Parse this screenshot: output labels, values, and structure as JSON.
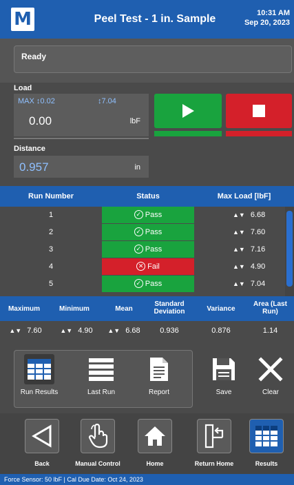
{
  "header": {
    "logo_text": "M",
    "title": "Peel Test - 1 in. Sample",
    "time": "10:31 AM",
    "date": "Sep 20, 2023"
  },
  "status": {
    "text": "Ready"
  },
  "load": {
    "label": "Load",
    "max_label": "MAX",
    "max_value": "0.02",
    "min_value": "7.04",
    "value": "0.00",
    "unit": "lbF"
  },
  "distance": {
    "label": "Distance",
    "value": "0.957",
    "unit": "in"
  },
  "results": {
    "headers": [
      "Run Number",
      "Status",
      "Max Load [lbF]"
    ],
    "rows": [
      {
        "run": "1",
        "status": "Pass",
        "max": "6.68"
      },
      {
        "run": "2",
        "status": "Pass",
        "max": "7.60"
      },
      {
        "run": "3",
        "status": "Pass",
        "max": "7.16"
      },
      {
        "run": "4",
        "status": "Fail",
        "max": "4.90"
      },
      {
        "run": "5",
        "status": "Pass",
        "max": "7.04"
      }
    ]
  },
  "stats": {
    "headers": [
      "Maximum",
      "Minimum",
      "Mean",
      "Standard Deviation",
      "Variance",
      "Area (Last Run)"
    ],
    "values": [
      "7.60",
      "4.90",
      "6.68",
      "0.936",
      "0.876",
      "1.14"
    ]
  },
  "actions": {
    "run_results": "Run Results",
    "last_run": "Last Run",
    "report": "Report",
    "save": "Save",
    "clear": "Clear"
  },
  "nav": {
    "back": "Back",
    "manual_control": "Manual Control",
    "home": "Home",
    "return_home": "Return Home",
    "results": "Results"
  },
  "footer": {
    "text": "Force Sensor: 50 lbF  |  Cal Due Date: Oct 24, 2023"
  },
  "colors": {
    "header_blue": "#1f5fb0",
    "pass_green": "#19a33e",
    "fail_red": "#d4202a",
    "value_blue": "#8fc0ff"
  }
}
